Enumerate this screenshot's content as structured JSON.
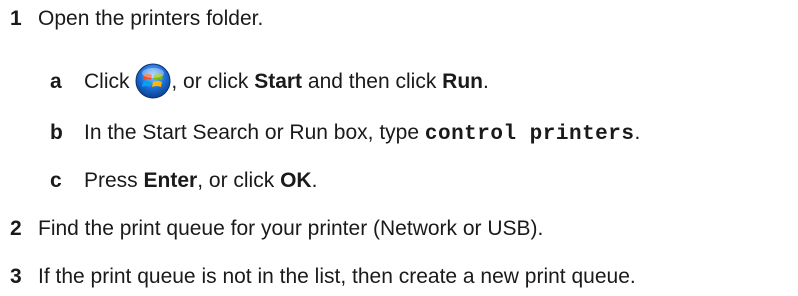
{
  "steps": [
    {
      "number": "1",
      "text": "Open the printers folder.",
      "substeps": [
        {
          "letter": "a",
          "text_1": "Click",
          "icon": "windows-start-orb-icon",
          "text_2": ", or click",
          "bold_1": "Start",
          "text_3": "and then click",
          "bold_2": "Run",
          "text_4": "."
        },
        {
          "letter": "b",
          "text_1": "In the Start Search or Run box, type",
          "code": "control printers",
          "text_2": "."
        },
        {
          "letter": "c",
          "text_1": "Press",
          "bold_1": "Enter",
          "text_2": ", or click",
          "bold_2": "OK",
          "text_3": "."
        }
      ]
    },
    {
      "number": "2",
      "text": "Find the print queue for your printer (Network or USB)."
    },
    {
      "number": "3",
      "text": "If the print queue is not in the list, then create a new print queue."
    }
  ],
  "colors": {
    "text": "#1a1a1a",
    "orb_blue": "#1e6fd9",
    "logo_red": "#f25022",
    "logo_green": "#7fba00",
    "logo_blue": "#00a4ef",
    "logo_yellow": "#ffb900"
  }
}
